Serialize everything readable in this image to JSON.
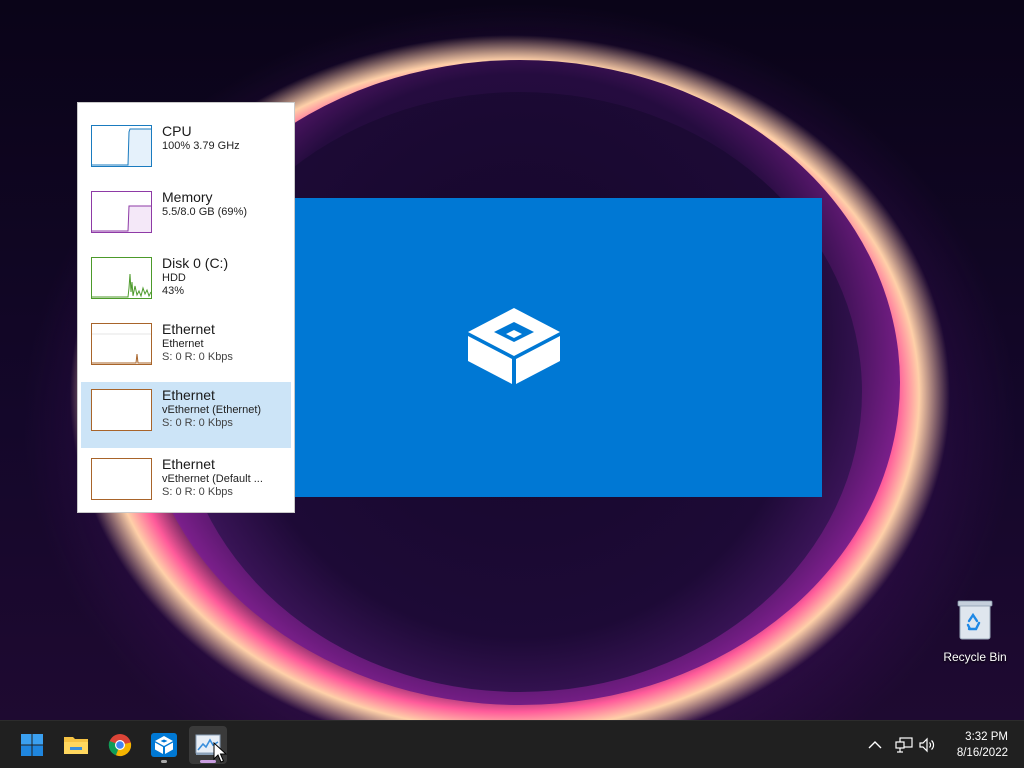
{
  "task_manager": {
    "items": [
      {
        "title": "CPU",
        "line1": "100%  3.79 GHz",
        "line2": "",
        "color": "#1a7bbf"
      },
      {
        "title": "Memory",
        "line1": "5.5/8.0 GB (69%)",
        "line2": "",
        "color": "#8e3aa6"
      },
      {
        "title": "Disk 0 (C:)",
        "line1": "HDD",
        "line2": "43%",
        "color": "#4c9a2a"
      },
      {
        "title": "Ethernet",
        "line1": "Ethernet",
        "line2": "S: 0  R: 0 Kbps",
        "color": "#a8642a"
      },
      {
        "title": "Ethernet",
        "line1": "vEthernet (Ethernet)",
        "line2": "S: 0  R: 0 Kbps",
        "color": "#a8642a"
      },
      {
        "title": "Ethernet",
        "line1": "vEthernet (Default ...",
        "line2": "S: 0  R: 0 Kbps",
        "color": "#a8642a"
      }
    ],
    "selected_index": 4
  },
  "desktop": {
    "recycle_bin_label": "Recycle Bin"
  },
  "taskbar": {
    "apps": [
      "start-icon",
      "file-explorer-icon",
      "chrome-icon",
      "sandbox-icon",
      "task-manager-icon"
    ],
    "time": "3:32 PM",
    "date": "8/16/2022"
  },
  "colors": {
    "sandbox_blue": "#0078d4",
    "taskbar": "#202020",
    "selection": "#cce4f7"
  }
}
